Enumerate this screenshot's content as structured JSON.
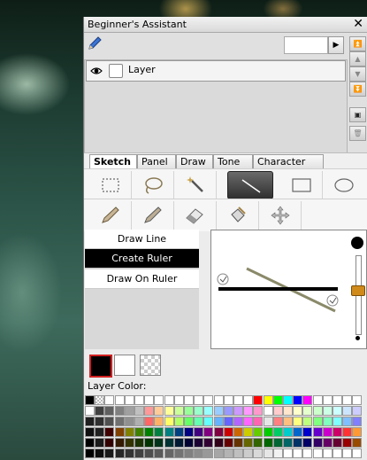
{
  "window": {
    "title": "Beginner's Assistant",
    "close_glyph": "✕"
  },
  "layers": {
    "opacity_value": "",
    "rows": [
      {
        "name": "Layer",
        "visible": true
      }
    ]
  },
  "tabs": [
    {
      "label": "Sketch",
      "active": true
    },
    {
      "label": "Panel",
      "active": false
    },
    {
      "label": "Draw",
      "active": false
    },
    {
      "label": "Tone",
      "active": false
    },
    {
      "label": "Character",
      "active": false
    }
  ],
  "tools_row1": [
    "rect-select-icon",
    "lasso-icon",
    "magic-wand-icon",
    "line-tool-icon",
    "rectangle-icon",
    "ellipse-icon"
  ],
  "tools_row1_active": "line-tool-icon",
  "tools_row2": [
    "pen-icon",
    "pencil-icon",
    "eraser-icon",
    "fill-bucket-icon",
    "move-icon"
  ],
  "line_options": [
    {
      "label": "Draw Line",
      "selected": false
    },
    {
      "label": "Create Ruler",
      "selected": true
    },
    {
      "label": "Draw On Ruler",
      "selected": false
    }
  ],
  "colors": {
    "main": "#000000",
    "sub": "#ffffff",
    "layer_color_label": "Layer Color:"
  },
  "palette": [
    [
      "#000000",
      "checker",
      "#ffffff",
      "#ffffff",
      "#ffffff",
      "#ffffff",
      "#ffffff",
      "#ffffff",
      "#ffffff",
      "#ffffff",
      "#ffffff",
      "#ffffff",
      "#ffffff",
      "#ffffff",
      "#ffffff",
      "#ffffff",
      "#ffffff",
      "#ff0000",
      "#ffff00",
      "#00ff00",
      "#00ffff",
      "#0000ff",
      "#ff00ff",
      "#ffffff",
      "#ffffff",
      "#ffffff",
      "#ffffff",
      "#ffffff"
    ],
    [
      "#ffffff",
      "#404040",
      "#606060",
      "#808080",
      "#a0a0a0",
      "#c0c0c0",
      "#ff9999",
      "#ffcc99",
      "#ffff99",
      "#ccff99",
      "#99ff99",
      "#99ffcc",
      "#99ffff",
      "#99ccff",
      "#9999ff",
      "#cc99ff",
      "#ff99ff",
      "#ff99cc",
      "#ffffff",
      "#ffcccc",
      "#ffe5cc",
      "#ffffcc",
      "#e5ffcc",
      "#ccffcc",
      "#ccffe5",
      "#ccffff",
      "#cce5ff",
      "#ccccff"
    ],
    [
      "#202020",
      "#303030",
      "#505050",
      "#707070",
      "#909090",
      "#b0b0b0",
      "#ff6666",
      "#ffb266",
      "#ffff66",
      "#b2ff66",
      "#66ff66",
      "#66ffb2",
      "#66ffff",
      "#66b2ff",
      "#6666ff",
      "#b266ff",
      "#ff66ff",
      "#ff66b2",
      "#e6e6e6",
      "#ff8080",
      "#ffbf80",
      "#ffff80",
      "#bfff80",
      "#80ff80",
      "#80ffbf",
      "#80ffff",
      "#80bfff",
      "#8080ff"
    ],
    [
      "#101010",
      "#202020",
      "#400000",
      "#804000",
      "#808000",
      "#408000",
      "#008000",
      "#008040",
      "#008080",
      "#004080",
      "#000080",
      "#400080",
      "#800080",
      "#800040",
      "#cc0000",
      "#cc6600",
      "#cccc00",
      "#66cc00",
      "#00cc00",
      "#00cc66",
      "#00cccc",
      "#0066cc",
      "#0000cc",
      "#6600cc",
      "#cc00cc",
      "#cc0066",
      "#ff3333",
      "#ff9933"
    ],
    [
      "#000000",
      "#1a1a1a",
      "#330000",
      "#331a00",
      "#333300",
      "#1a3300",
      "#003300",
      "#00331a",
      "#003333",
      "#001a33",
      "#000033",
      "#1a0033",
      "#330033",
      "#33001a",
      "#660000",
      "#663300",
      "#666600",
      "#336600",
      "#006600",
      "#006633",
      "#006666",
      "#003366",
      "#000066",
      "#330066",
      "#660066",
      "#660033",
      "#990000",
      "#994c00"
    ],
    [
      "#000000",
      "#0d0d0d",
      "#1a1a1a",
      "#262626",
      "#333333",
      "#404040",
      "#4d4d4d",
      "#595959",
      "#666666",
      "#737373",
      "#808080",
      "#8c8c8c",
      "#999999",
      "#a6a6a6",
      "#b3b3b3",
      "#bfbfbf",
      "#cccccc",
      "#d9d9d9",
      "#e6e6e6",
      "#f2f2f2",
      "#ffffff",
      "#ffffff",
      "#ffffff",
      "#ffffff",
      "#ffffff",
      "#ffffff",
      "#ffffff",
      "#ffffff"
    ]
  ]
}
